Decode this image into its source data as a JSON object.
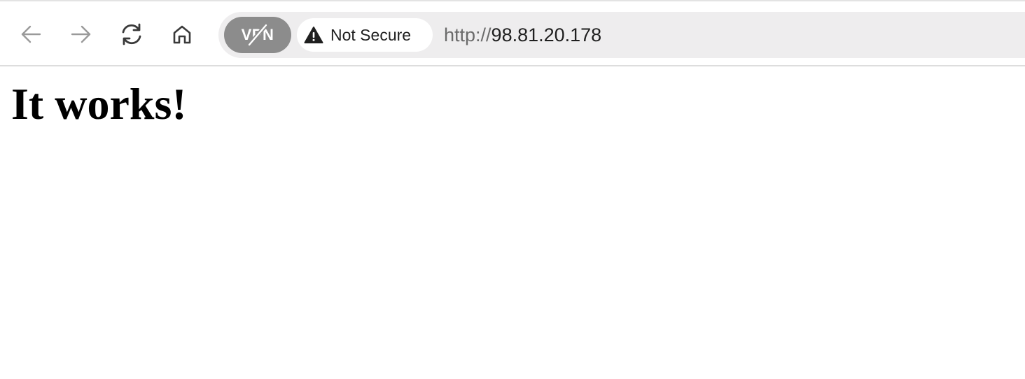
{
  "toolbar": {
    "back_icon": "arrow-left-icon",
    "forward_icon": "arrow-right-icon",
    "reload_icon": "reload-icon",
    "home_icon": "home-icon"
  },
  "address_bar": {
    "vpn_label": "VPN",
    "vpn_state": "off",
    "security_icon": "warning-triangle-icon",
    "security_label": "Not Secure",
    "url_scheme": "http://",
    "url_host": "98.81.20.178"
  },
  "page": {
    "heading": "It works!"
  },
  "colors": {
    "vpn_pill_bg": "#8c8c8c",
    "url_bar_bg": "#eeedee",
    "disabled_nav_icon": "#9a9a9a",
    "active_nav_icon": "#3a3a3a"
  }
}
